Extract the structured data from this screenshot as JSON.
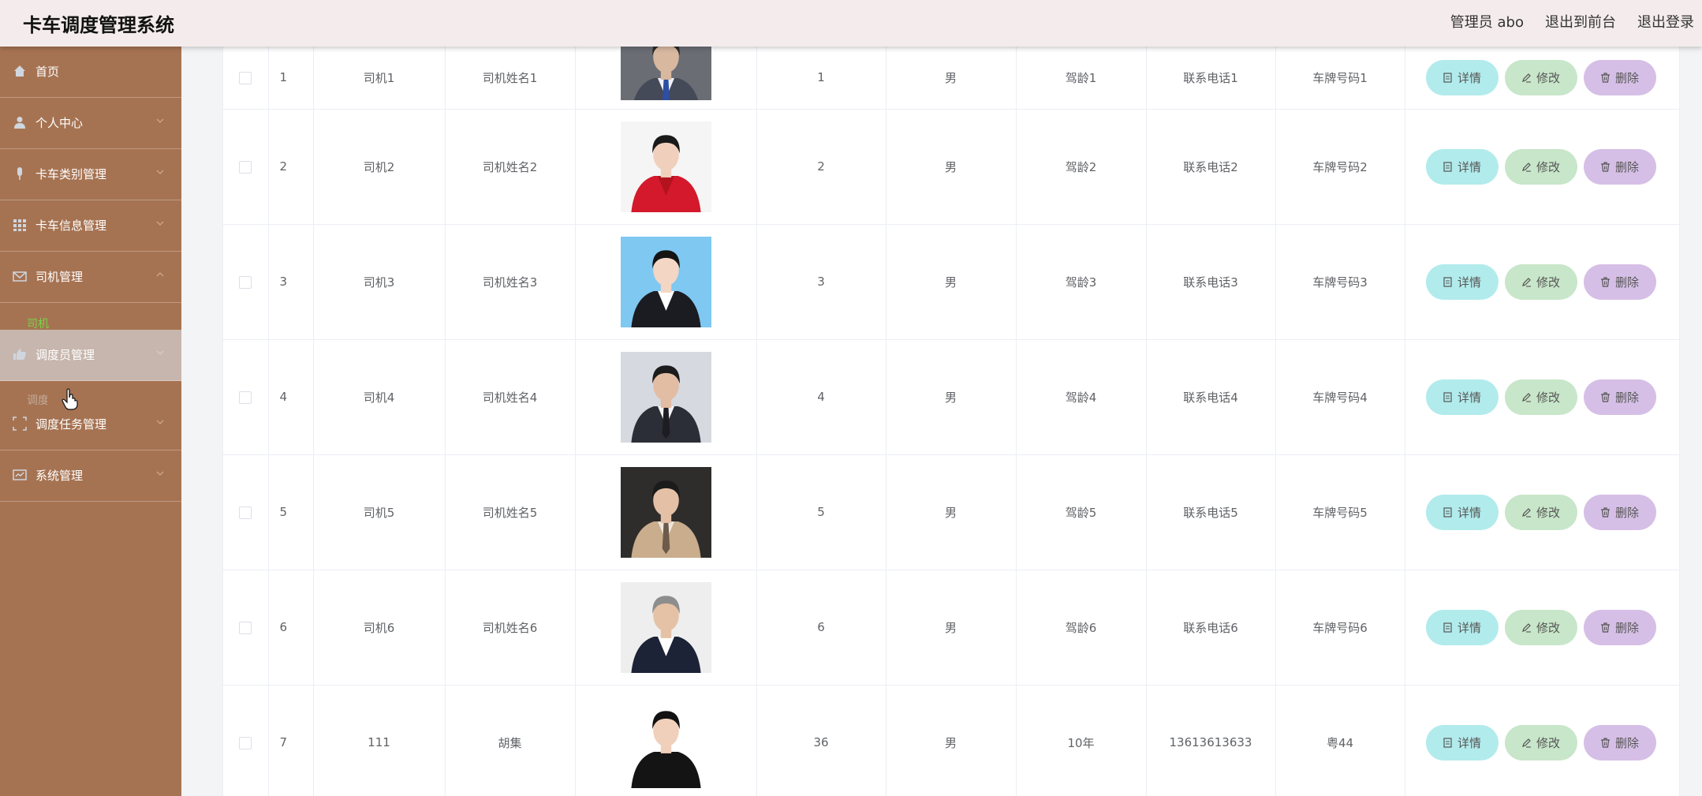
{
  "app": {
    "title": "卡车调度管理系统",
    "header_links": [
      "管理员 abo",
      "退出到前台",
      "退出登录"
    ]
  },
  "sidebar": {
    "items": [
      {
        "label": "首页",
        "icon": "home-icon"
      },
      {
        "label": "个人中心",
        "icon": "user-icon"
      },
      {
        "label": "卡车类别管理",
        "icon": "microphone-icon"
      },
      {
        "label": "卡车信息管理",
        "icon": "grid-icon"
      },
      {
        "label": "司机管理",
        "icon": "mail-icon"
      },
      {
        "label": "调度员管理",
        "icon": "thumbs-up-icon"
      },
      {
        "label": "调度任务管理",
        "icon": "frame-icon"
      },
      {
        "label": "系统管理",
        "icon": "message-icon"
      }
    ],
    "submenu_driver": "司机",
    "submenu_dispatcher_partial": "调度员"
  },
  "table": {
    "buttons": {
      "detail": "详情",
      "edit": "修改",
      "delete": "删除"
    },
    "rows": [
      {
        "index": "1",
        "account": "司机1",
        "name": "司机姓名1",
        "age": "1",
        "gender": "男",
        "driving_years": "驾龄1",
        "phone": "联系电话1",
        "plate": "车牌号码1",
        "photo": "grey-suit-man"
      },
      {
        "index": "2",
        "account": "司机2",
        "name": "司机姓名2",
        "age": "2",
        "gender": "男",
        "driving_years": "驾龄2",
        "phone": "联系电话2",
        "plate": "车牌号码2",
        "photo": "red-jacket-woman"
      },
      {
        "index": "3",
        "account": "司机3",
        "name": "司机姓名3",
        "age": "3",
        "gender": "男",
        "driving_years": "驾龄3",
        "phone": "联系电话3",
        "plate": "车牌号码3",
        "photo": "blue-bg-woman"
      },
      {
        "index": "4",
        "account": "司机4",
        "name": "司机姓名4",
        "age": "4",
        "gender": "男",
        "driving_years": "驾龄4",
        "phone": "联系电话4",
        "plate": "车牌号码4",
        "photo": "dark-suit-man"
      },
      {
        "index": "5",
        "account": "司机5",
        "name": "司机姓名5",
        "age": "5",
        "gender": "男",
        "driving_years": "驾龄5",
        "phone": "联系电话5",
        "plate": "车牌号码5",
        "photo": "beige-suit-man"
      },
      {
        "index": "6",
        "account": "司机6",
        "name": "司机姓名6",
        "age": "6",
        "gender": "男",
        "driving_years": "驾龄6",
        "phone": "联系电话6",
        "plate": "车牌号码6",
        "photo": "grey-hair-man"
      },
      {
        "index": "7",
        "account": "111",
        "name": "胡集",
        "age": "36",
        "gender": "男",
        "driving_years": "10年",
        "phone": "13613613633",
        "plate": "粤44",
        "photo": "smiling-young-man"
      }
    ]
  },
  "colors": {
    "sidebar_bg": "#a67352",
    "header_bg": "#f4ecec",
    "detail_btn": "#b2ebec",
    "edit_btn": "#c8e6c9",
    "delete_btn": "#d6bfe6",
    "submenu_active": "#7ad34a"
  }
}
